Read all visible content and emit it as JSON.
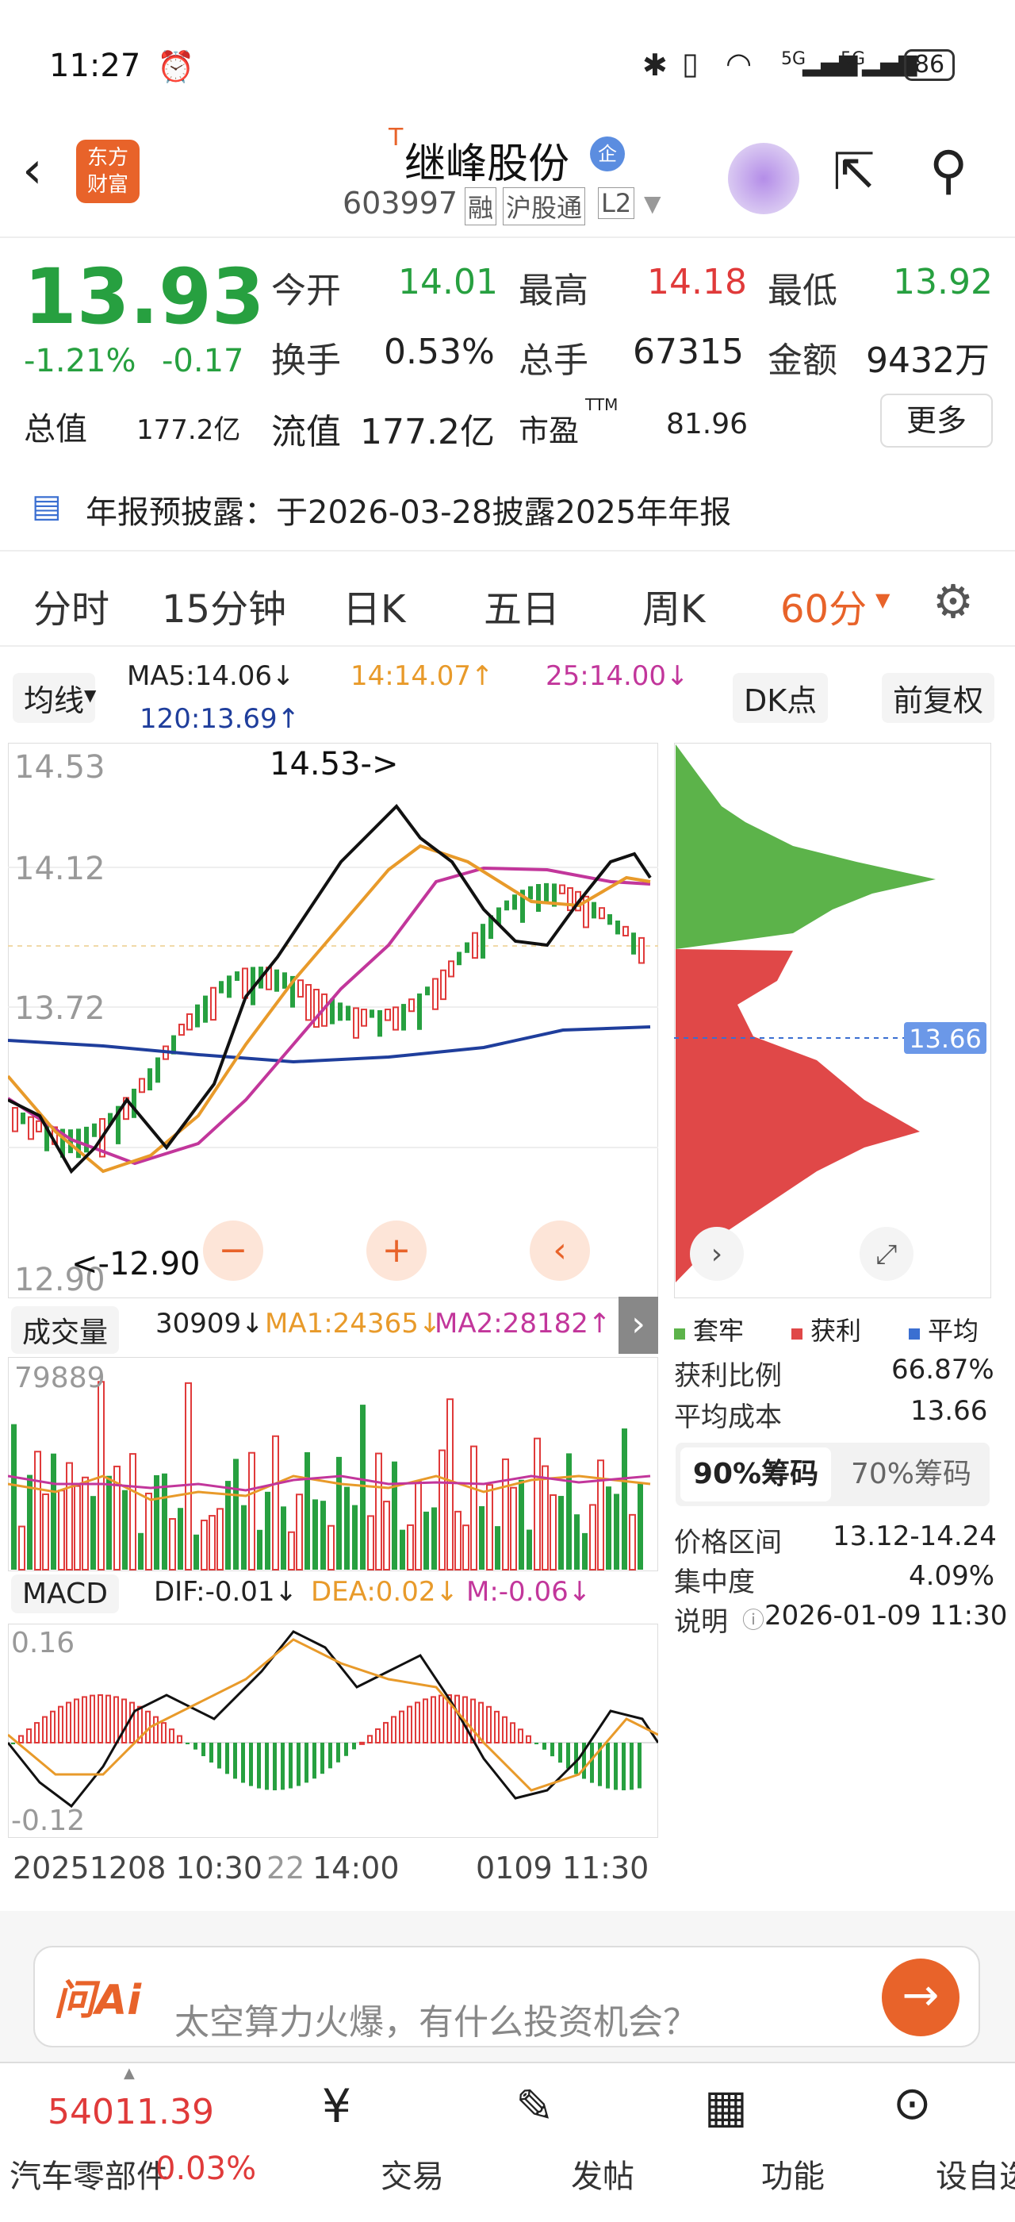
{
  "status": {
    "time": "11:27",
    "battery": "86",
    "sig1": "5G",
    "sig2": "5G"
  },
  "header": {
    "title": "继峰股份",
    "title_sup": "T",
    "badge": "企",
    "code": "603997",
    "tags": [
      "融",
      "沪股通",
      "L2"
    ]
  },
  "quote": {
    "price": "13.93",
    "pct": "-1.21%",
    "chg": "-0.17",
    "rows": [
      [
        "今开",
        "14.01",
        "最高",
        "14.18",
        "最低",
        "13.92"
      ],
      [
        "换手",
        "0.53%",
        "总手",
        "67315",
        "金额",
        "9432万"
      ]
    ],
    "total_label": "总值",
    "total": "177.2亿",
    "float_label": "流值",
    "float": "177.2亿",
    "pe_label": "市盈",
    "pe_sup": "TTM",
    "pe": "81.96",
    "more": "更多"
  },
  "notice": "年报预披露：于2026-03-28披露2025年年报",
  "tabs": [
    "分时",
    "15分钟",
    "日K",
    "五日",
    "周K",
    "60分"
  ],
  "ma": {
    "label": "均线",
    "ma5": "MA5:14.06↓",
    "ma14": "14:14.07↑",
    "ma25": "25:14.00↓",
    "ma120": "120:13.69↑",
    "dk": "DK点",
    "fq": "前复权"
  },
  "price_axis": {
    "top": "14.53",
    "mid": "14.12",
    "low": "13.72",
    "bottom": "12.90",
    "high_mark": "14.53->",
    "low_mark": "<-12.90"
  },
  "chips": {
    "avg_label": "13.66",
    "legend": [
      "套牢",
      "获利",
      "平均"
    ],
    "rows": [
      [
        "获利比例",
        "66.87%"
      ],
      [
        "平均成本",
        "13.66"
      ]
    ],
    "tab_a": "90%筹码",
    "tab_b": "70%筹码",
    "range": [
      "价格区间",
      "13.12-14.24"
    ],
    "conc": [
      "集中度",
      "4.09%"
    ],
    "note": [
      "说明",
      "2026-01-09 11:30"
    ]
  },
  "volume": {
    "label": "成交量",
    "v": "30909↓",
    "ma1": "MA1:24365↓",
    "ma2": "MA2:28182↑",
    "top": "79889"
  },
  "macd": {
    "label": "MACD",
    "dif": "DIF:-0.01↓",
    "dea": "DEA:0.02↓",
    "m": "M:-0.06↓",
    "top": "0.16",
    "bottom": "-0.12"
  },
  "xaxis": [
    "20251208 10:30",
    "22",
    "14:00",
    "0109 11:30"
  ],
  "ai": {
    "logo": "问Ai",
    "placeholder": "太空算力火爆，有什么投资机会？"
  },
  "footer": {
    "index": "54011.39",
    "sector": "汽车零部件",
    "sector_pct": "0.03%",
    "items": [
      "交易",
      "发帖",
      "功能",
      "设自选"
    ]
  },
  "colors": {
    "up": "#e03a3a",
    "down": "#27a040",
    "accent": "#e8632a"
  }
}
